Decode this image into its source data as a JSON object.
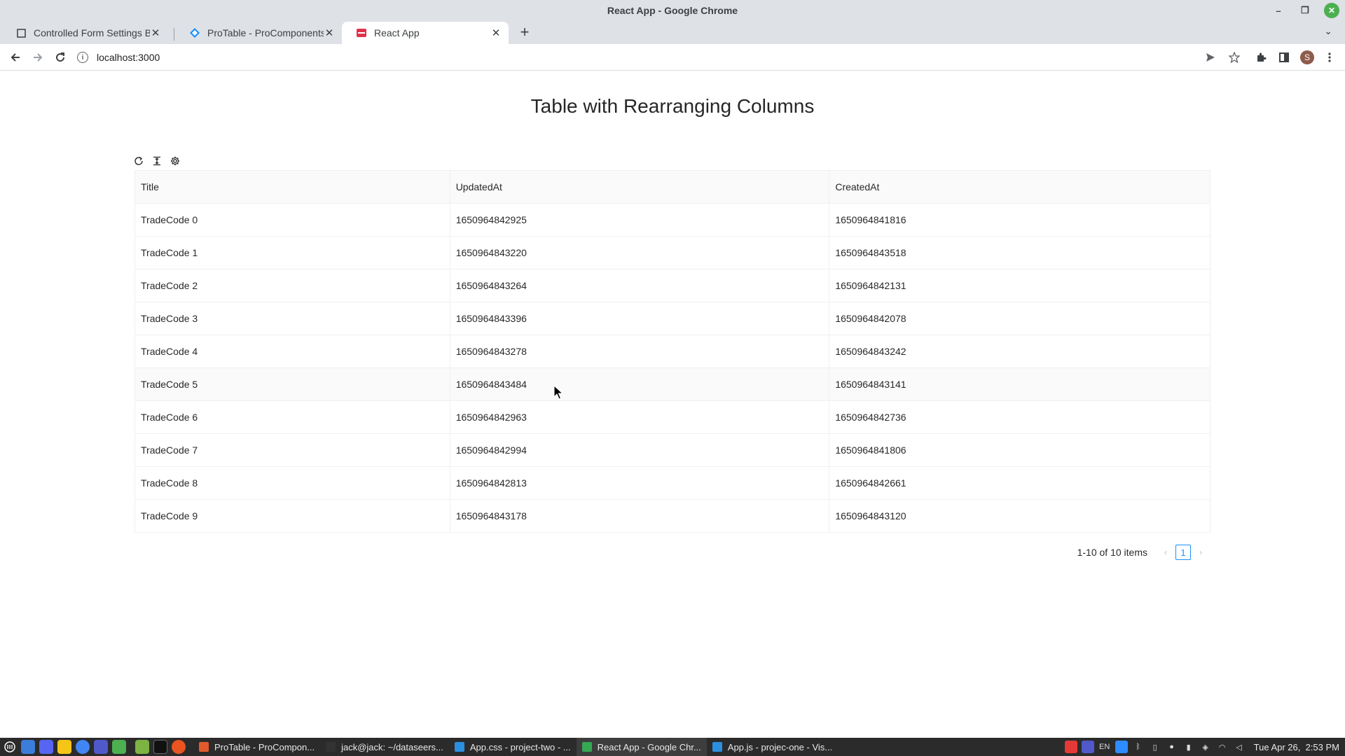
{
  "window": {
    "title": "React App - Google Chrome",
    "minimize": "–",
    "maximize": "❐",
    "close": "✕"
  },
  "tabs": [
    {
      "title": "Controlled Form Settings Bar",
      "icon": "page-icon",
      "close": "✕"
    },
    {
      "title": "ProTable - ProComponents",
      "icon": "procomponents-icon",
      "close": "✕"
    },
    {
      "title": "React App",
      "icon": "react-app-icon",
      "close": "✕"
    }
  ],
  "toolbar": {
    "url": "localhost:3000",
    "new_tab": "+",
    "tab_list": "⌄"
  },
  "page": {
    "title": "Table with Rearranging Columns"
  },
  "table": {
    "columns": [
      "Title",
      "UpdatedAt",
      "CreatedAt"
    ],
    "rows": [
      [
        "TradeCode 0",
        "1650964842925",
        "1650964841816"
      ],
      [
        "TradeCode 1",
        "1650964843220",
        "1650964843518"
      ],
      [
        "TradeCode 2",
        "1650964843264",
        "1650964842131"
      ],
      [
        "TradeCode 3",
        "1650964843396",
        "1650964842078"
      ],
      [
        "TradeCode 4",
        "1650964843278",
        "1650964843242"
      ],
      [
        "TradeCode 5",
        "1650964843484",
        "1650964843141"
      ],
      [
        "TradeCode 6",
        "1650964842963",
        "1650964842736"
      ],
      [
        "TradeCode 7",
        "1650964842994",
        "1650964841806"
      ],
      [
        "TradeCode 8",
        "1650964842813",
        "1650964842661"
      ],
      [
        "TradeCode 9",
        "1650964843178",
        "1650964843120"
      ]
    ],
    "hovered_row_index": 5
  },
  "pagination": {
    "total_text": "1-10 of 10 items",
    "current_page": "1",
    "prev": "‹",
    "next": "›"
  },
  "taskbar": {
    "tasks": [
      {
        "label": "ProTable - ProCompon...",
        "color": "#e25a2b"
      },
      {
        "label": "jack@jack: ~/dataseers...",
        "color": "#333333"
      },
      {
        "label": "App.css - project-two - ...",
        "color": "#2b8fe0"
      },
      {
        "label": "React App - Google Chr...",
        "color": "#34a853"
      },
      {
        "label": "App.js - projec-one - Vis...",
        "color": "#2b8fe0"
      }
    ],
    "active_task_index": 3,
    "language": "EN",
    "clock": "Tue Apr 26,  2:53 PM"
  },
  "colors": {
    "accent": "#1890ff",
    "header_bg": "#fafafa",
    "border": "#f0f0f0",
    "chrome_frame": "#dee1e6"
  }
}
